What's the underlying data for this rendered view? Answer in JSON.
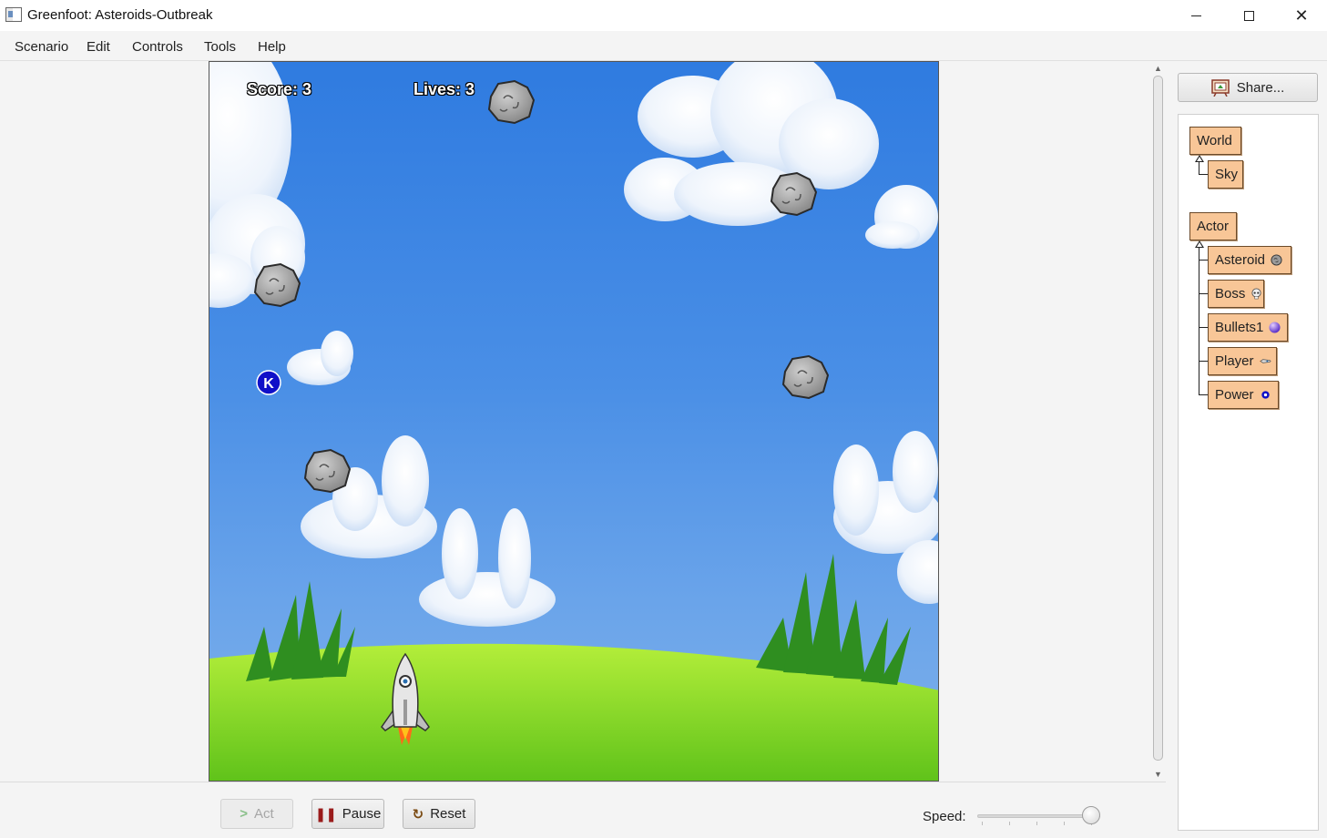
{
  "window": {
    "title": "Greenfoot: Asteroids-Outbreak"
  },
  "menubar": {
    "items": [
      "Scenario",
      "Edit",
      "Controls",
      "Tools",
      "Help"
    ]
  },
  "world": {
    "score_text": "Score: 3",
    "lives_text": "Lives: 3",
    "power_label": "K"
  },
  "controls": {
    "act_label": "Act",
    "pause_label": "Pause",
    "reset_label": "Reset",
    "speed_label": "Speed:",
    "speed_value": 0.92
  },
  "right_panel": {
    "share_label": "Share...",
    "world_classes": [
      "World",
      "Sky"
    ],
    "actor_classes": [
      "Actor",
      "Asteroid",
      "Boss",
      "Bullets1",
      "Player",
      "Power"
    ]
  },
  "icons": [
    "app-icon",
    "share-icon",
    "asteroid-icon",
    "boss-skull-icon",
    "bullet-orb-icon",
    "player-ship-icon",
    "power-dot-icon"
  ]
}
